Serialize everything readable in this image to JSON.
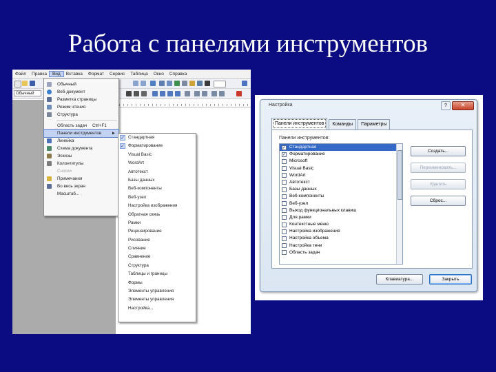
{
  "slide": {
    "title": "Работа с панелями инструментов"
  },
  "word": {
    "menubar": [
      "Файл",
      "Правка",
      "Вид",
      "Вставка",
      "Формат",
      "Сервис",
      "Таблица",
      "Окно",
      "Справка"
    ],
    "style_box": "Обычный",
    "view_menu": [
      {
        "label": "Обычный",
        "icon": "normal-view-icon",
        "color": "#9aa5bd"
      },
      {
        "label": "Веб-документ",
        "icon": "web-doc-icon",
        "color": "#3b7fd0"
      },
      {
        "label": "Разметка страницы",
        "icon": "page-layout-icon",
        "color": "#5b6f99"
      },
      {
        "label": "Режим чтения",
        "icon": "reading-mode-icon",
        "color": "#6c8db8"
      },
      {
        "label": "Структура",
        "icon": "outline-view-icon",
        "color": "#7a8599"
      },
      {
        "label": "Область задач",
        "shortcut": "Ctrl+F1"
      },
      {
        "label": "Панели инструментов",
        "arrow": "►",
        "highlight": true
      },
      {
        "label": "Линейка",
        "icon": "ruler-check-icon",
        "color": "#4d72b9"
      },
      {
        "label": "Схема документа",
        "icon": "doc-map-icon",
        "color": "#4a8a6a"
      },
      {
        "label": "Эскизы",
        "icon": "thumbnails-icon",
        "color": "#8d7a4a"
      },
      {
        "label": "Колонтитулы",
        "icon": "header-footer-icon",
        "color": "#7a7a7a"
      },
      {
        "label": "Сноски",
        "dim": true
      },
      {
        "label": "Примечания",
        "icon": "comments-icon",
        "color": "#d9b43a"
      },
      {
        "label": "Во весь экран",
        "icon": "fullscreen-icon",
        "color": "#5b6f99"
      },
      {
        "label": "Масштаб..."
      }
    ],
    "toolbars_submenu": [
      {
        "label": "Стандартная",
        "checked": true
      },
      {
        "label": "Форматирование",
        "checked": true
      },
      {
        "label": "Visual Basic"
      },
      {
        "label": "WordArt"
      },
      {
        "label": "Автотекст"
      },
      {
        "label": "Базы данных"
      },
      {
        "label": "Веб-компоненты"
      },
      {
        "label": "Веб-узел"
      },
      {
        "label": "Настройка изображения"
      },
      {
        "label": "Обратная связь"
      },
      {
        "label": "Рамки"
      },
      {
        "label": "Рецензирование"
      },
      {
        "label": "Рисование"
      },
      {
        "label": "Слияние"
      },
      {
        "label": "Сравнение"
      },
      {
        "label": "Структура"
      },
      {
        "label": "Таблицы и границы"
      },
      {
        "label": "Формы"
      },
      {
        "label": "Элементы управления"
      },
      {
        "label": "Элементы управления"
      },
      {
        "label": "Настройка..."
      }
    ]
  },
  "dialog": {
    "title": "Настройка",
    "help": "?",
    "close": "✕",
    "tabs": [
      "Панели инструментов",
      "Команды",
      "Параметры"
    ],
    "list_label": "Панели инструментов:",
    "toolbars": [
      {
        "label": "Стандартная",
        "checked": true,
        "selected": true
      },
      {
        "label": "Форматирование",
        "checked": true
      },
      {
        "label": "Microsoft"
      },
      {
        "label": "Visual Basic"
      },
      {
        "label": "WordArt"
      },
      {
        "label": "Автотекст"
      },
      {
        "label": "Базы данных"
      },
      {
        "label": "Веб-компоненты"
      },
      {
        "label": "Веб-узел"
      },
      {
        "label": "Выход функциональных клавиш"
      },
      {
        "label": "Для рамки"
      },
      {
        "label": "Контекстные меню"
      },
      {
        "label": "Настройка изображения"
      },
      {
        "label": "Настройка объема"
      },
      {
        "label": "Настройка тени"
      },
      {
        "label": "Область задач"
      }
    ],
    "buttons": {
      "create": "Создать...",
      "rename": "Переименовать...",
      "delete": "Удалить",
      "reset": "Сброс...",
      "keyboard": "Клавиатура...",
      "close": "Закрыть"
    }
  }
}
